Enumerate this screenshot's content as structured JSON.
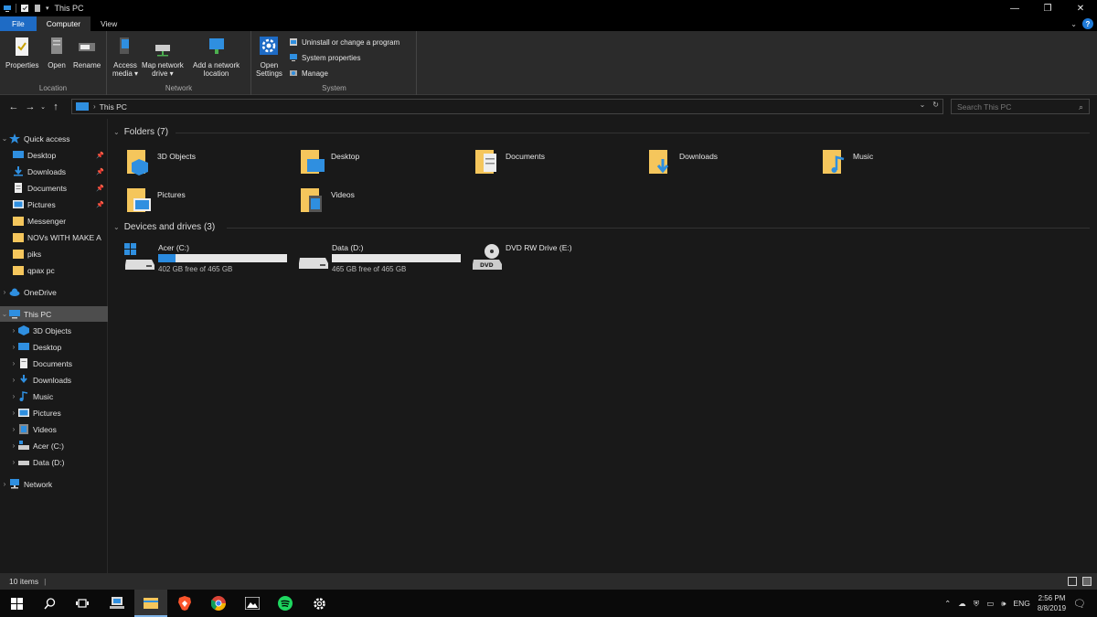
{
  "window": {
    "title": "This PC",
    "controls": {
      "minimize": "—",
      "maximize": "❐",
      "close": "✕"
    }
  },
  "tabs": [
    {
      "label": "File"
    },
    {
      "label": "Computer"
    },
    {
      "label": "View"
    }
  ],
  "ribbon": {
    "location_group": {
      "label": "Location",
      "properties": "Properties",
      "open": "Open",
      "rename": "Rename"
    },
    "network_group": {
      "label": "Network",
      "access_media_1": "Access",
      "access_media_2": "media ▾",
      "map_drive_1": "Map network",
      "map_drive_2": "drive ▾",
      "add_location_1": "Add a network",
      "add_location_2": "location"
    },
    "system_group": {
      "label": "System",
      "open_settings_1": "Open",
      "open_settings_2": "Settings",
      "uninstall": "Uninstall or change a program",
      "system_properties": "System properties",
      "manage": "Manage"
    }
  },
  "address": {
    "path": "This PC",
    "search_placeholder": "Search This PC"
  },
  "nav": {
    "quick_access": "Quick access",
    "quick_items": [
      {
        "label": "Desktop",
        "pinned": true
      },
      {
        "label": "Downloads",
        "pinned": true
      },
      {
        "label": "Documents",
        "pinned": true
      },
      {
        "label": "Pictures",
        "pinned": true
      },
      {
        "label": "Messenger"
      },
      {
        "label": "NOVs WITH MAKE A"
      },
      {
        "label": "piks"
      },
      {
        "label": "qpax pc"
      }
    ],
    "onedrive": "OneDrive",
    "this_pc": "This PC",
    "pc_items": [
      {
        "label": "3D Objects"
      },
      {
        "label": "Desktop"
      },
      {
        "label": "Documents"
      },
      {
        "label": "Downloads"
      },
      {
        "label": "Music"
      },
      {
        "label": "Pictures"
      },
      {
        "label": "Videos"
      },
      {
        "label": "Acer (C:)"
      },
      {
        "label": "Data (D:)"
      }
    ],
    "network": "Network"
  },
  "content": {
    "folders_header": "Folders (7)",
    "folders": [
      {
        "name": "3D Objects"
      },
      {
        "name": "Desktop"
      },
      {
        "name": "Documents"
      },
      {
        "name": "Downloads"
      },
      {
        "name": "Music"
      },
      {
        "name": "Pictures"
      },
      {
        "name": "Videos"
      }
    ],
    "drives_header": "Devices and drives (3)",
    "drives": [
      {
        "name": "Acer (C:)",
        "free_text": "402 GB free of 465 GB",
        "used_fraction": 0.135
      },
      {
        "name": "Data (D:)",
        "free_text": "465 GB free of 465 GB",
        "used_fraction": 0.0
      },
      {
        "name": "DVD RW Drive (E:)"
      }
    ]
  },
  "status": {
    "items_count": "10 items"
  },
  "taskbar": {
    "time": "2:56 PM",
    "date": "8/8/2019",
    "language": "ENG"
  },
  "colors": {
    "accent": "#1e6bc5",
    "folder_yellow": "#f5c65c",
    "drive_bar": "#2a8be0"
  }
}
